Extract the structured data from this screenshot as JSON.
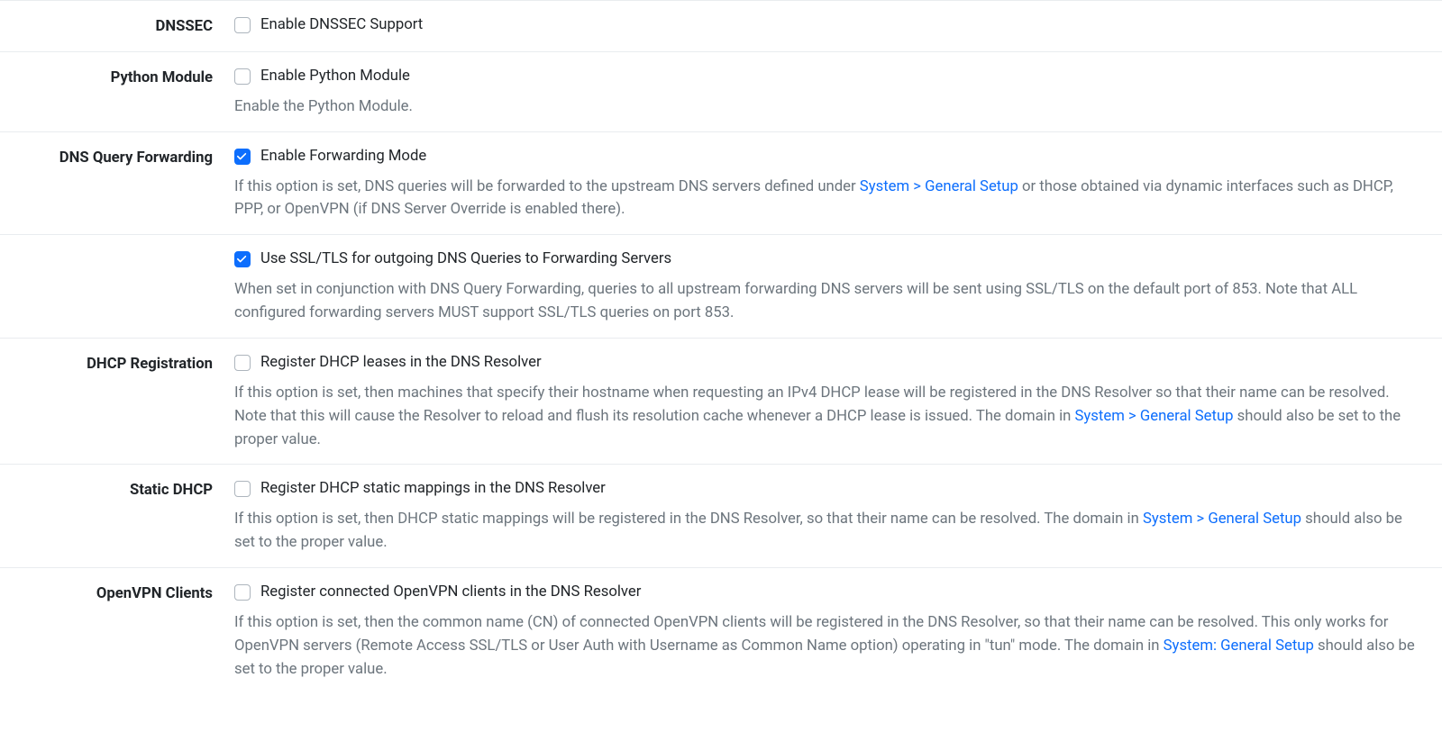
{
  "rows": {
    "dnssec": {
      "label": "DNSSEC",
      "checkbox_label": "Enable DNSSEC Support",
      "checked": false
    },
    "python": {
      "label": "Python Module",
      "checkbox_label": "Enable Python Module",
      "checked": false,
      "help": "Enable the Python Module."
    },
    "forwarding": {
      "label": "DNS Query Forwarding",
      "checkbox_label": "Enable Forwarding Mode",
      "checked": true,
      "help_pre": "If this option is set, DNS queries will be forwarded to the upstream DNS servers defined under ",
      "help_link": "System > General Setup",
      "help_post": " or those obtained via dynamic interfaces such as DHCP, PPP, or OpenVPN (if DNS Server Override is enabled there)."
    },
    "ssl": {
      "checkbox_label": "Use SSL/TLS for outgoing DNS Queries to Forwarding Servers",
      "checked": true,
      "help": "When set in conjunction with DNS Query Forwarding, queries to all upstream forwarding DNS servers will be sent using SSL/TLS on the default port of 853. Note that ALL configured forwarding servers MUST support SSL/TLS queries on port 853."
    },
    "dhcp_reg": {
      "label": "DHCP Registration",
      "checkbox_label": "Register DHCP leases in the DNS Resolver",
      "checked": false,
      "help_pre": "If this option is set, then machines that specify their hostname when requesting an IPv4 DHCP lease will be registered in the DNS Resolver so that their name can be resolved. Note that this will cause the Resolver to reload and flush its resolution cache whenever a DHCP lease is issued. The domain in ",
      "help_link": "System > General Setup",
      "help_post": " should also be set to the proper value."
    },
    "static_dhcp": {
      "label": "Static DHCP",
      "checkbox_label": "Register DHCP static mappings in the DNS Resolver",
      "checked": false,
      "help_pre": "If this option is set, then DHCP static mappings will be registered in the DNS Resolver, so that their name can be resolved. The domain in ",
      "help_link": "System > General Setup",
      "help_post": " should also be set to the proper value."
    },
    "openvpn": {
      "label": "OpenVPN Clients",
      "checkbox_label": "Register connected OpenVPN clients in the DNS Resolver",
      "checked": false,
      "help_pre": "If this option is set, then the common name (CN) of connected OpenVPN clients will be registered in the DNS Resolver, so that their name can be resolved. This only works for OpenVPN servers (Remote Access SSL/TLS or User Auth with Username as Common Name option) operating in \"tun\" mode. The domain in ",
      "help_link": "System: General Setup",
      "help_post": " should also be set to the proper value."
    }
  }
}
